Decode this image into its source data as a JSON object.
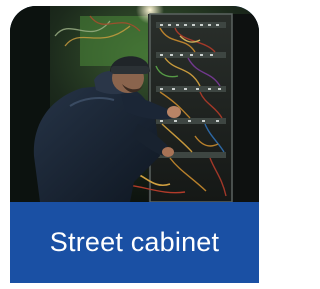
{
  "card": {
    "title": "Street cabinet",
    "image_description_icon": "photo-technician-at-cabinet",
    "caption_bg": "#1a50a4",
    "caption_text_color": "#ffffff"
  }
}
